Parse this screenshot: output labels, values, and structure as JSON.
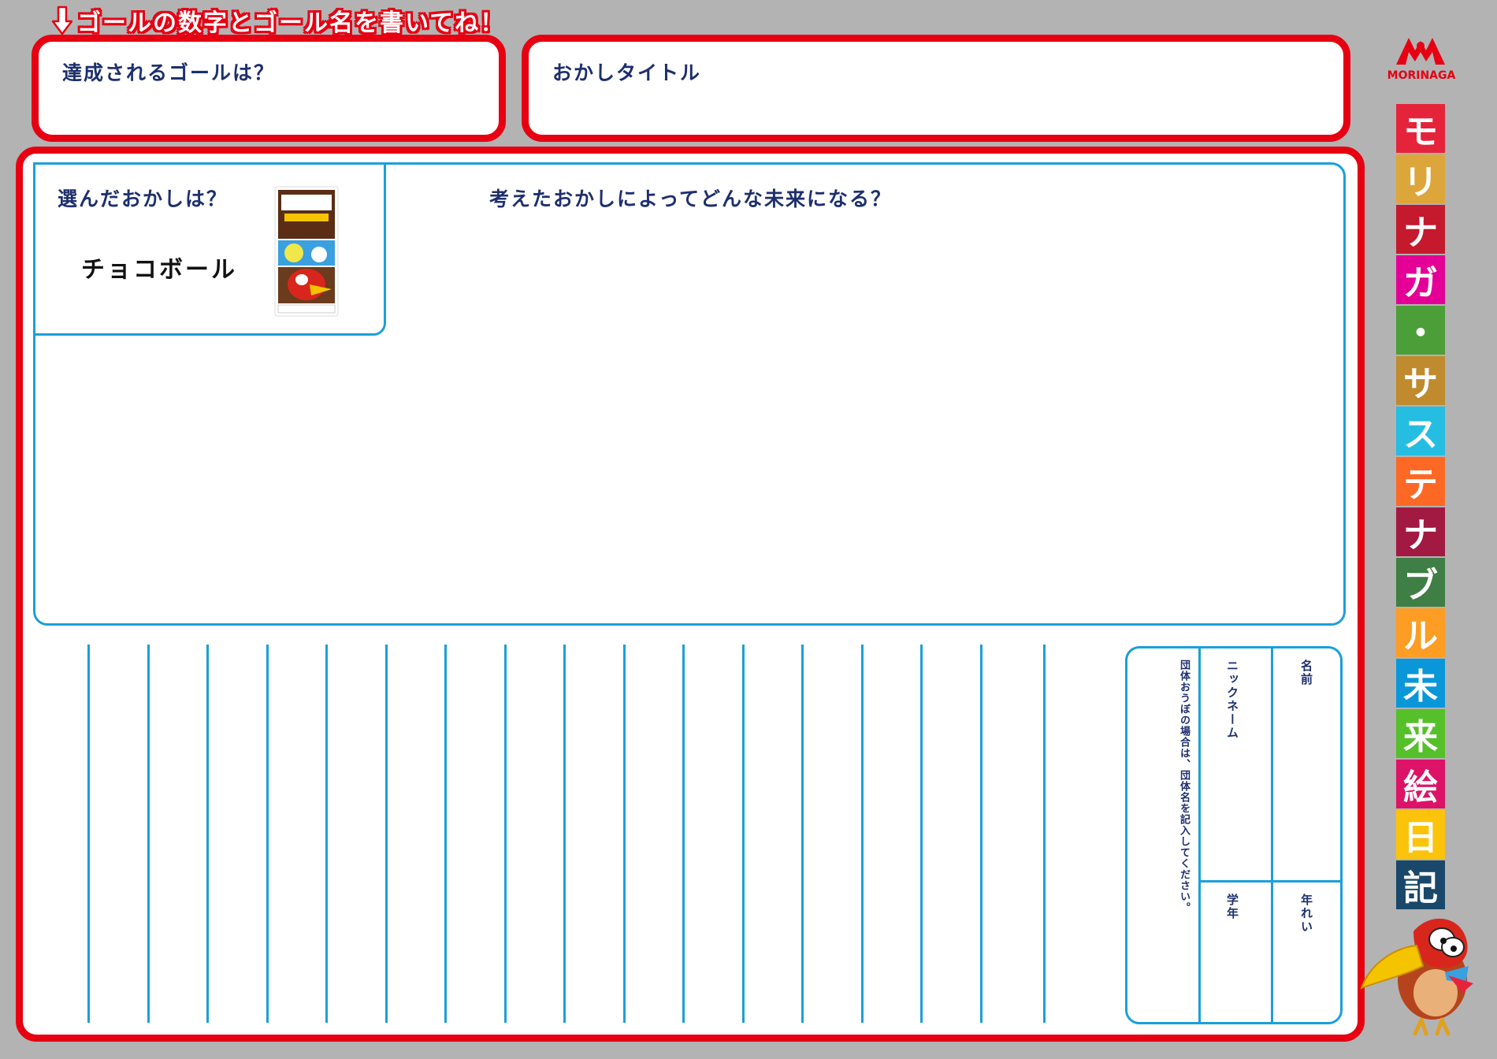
{
  "instruction": "ゴールの数字とゴール名を書いてね！",
  "goal_box": {
    "label": "達成されるゴールは？"
  },
  "title_box": {
    "label": "おかしタイトル"
  },
  "chosen": {
    "label": "選んだおかしは？",
    "product_name": "チョコボール"
  },
  "future": {
    "label": "考えたおかしによってどんな未来になる？"
  },
  "form": {
    "group_note": "団体おうぼの場合は、団体名を記入してください。",
    "nickname": "ニックネーム",
    "name": "名前",
    "grade": "学年",
    "age": "年れい"
  },
  "brand": {
    "logo_text": "MORINAGA"
  },
  "title_tiles": [
    {
      "char": "モ",
      "color": "#e5243b"
    },
    {
      "char": "リ",
      "color": "#dda63a"
    },
    {
      "char": "ナ",
      "color": "#c5192d"
    },
    {
      "char": "ガ",
      "color": "#e40097"
    },
    {
      "char": "・",
      "color": "#4c9f38"
    },
    {
      "char": "サ",
      "color": "#bf8b2e"
    },
    {
      "char": "ス",
      "color": "#26bde2"
    },
    {
      "char": "テ",
      "color": "#fd6925"
    },
    {
      "char": "ナ",
      "color": "#a21942"
    },
    {
      "char": "ブ",
      "color": "#3f7e44"
    },
    {
      "char": "ル",
      "color": "#fd9d24"
    },
    {
      "char": "未",
      "color": "#0a97d9"
    },
    {
      "char": "来",
      "color": "#56c02b"
    },
    {
      "char": "絵",
      "color": "#dd1367"
    },
    {
      "char": "日",
      "color": "#fcc30b"
    },
    {
      "char": "記",
      "color": "#19486a"
    }
  ],
  "colors": {
    "accent_red": "#e60012",
    "line_blue": "#1aa0d8",
    "label_navy": "#1d2f6e",
    "background": "#b3b3b3"
  }
}
